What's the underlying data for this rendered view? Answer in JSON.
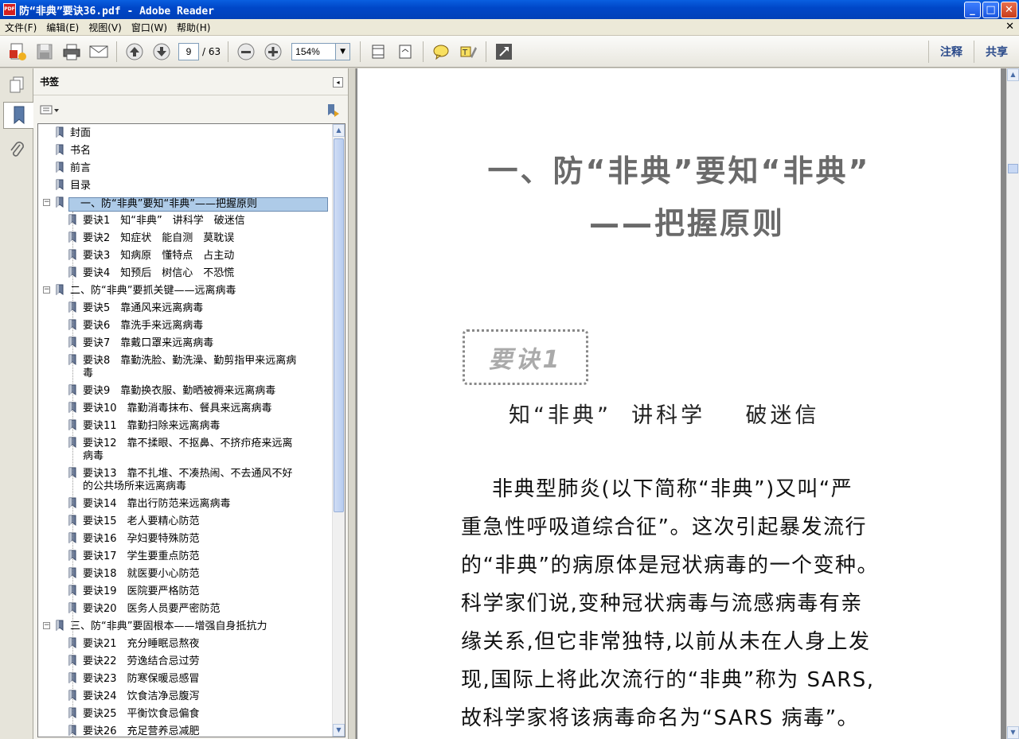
{
  "window": {
    "title": "防“非典”要诀36.pdf - Adobe Reader",
    "app_icon": "PDF",
    "min": "_",
    "max": "□",
    "close": "✕"
  },
  "menu": [
    "文件(F)",
    "编辑(E)",
    "视图(V)",
    "窗口(W)",
    "帮助(H)"
  ],
  "toolbar": {
    "page_current": "9",
    "page_total": "/ 63",
    "zoom": "154%",
    "comment_label": "注释",
    "share_label": "共享"
  },
  "panel": {
    "title": "书签",
    "collapse": "◂"
  },
  "bookmarks": [
    {
      "label": "封面",
      "level": 0,
      "toggle": ""
    },
    {
      "label": "书名",
      "level": 0,
      "toggle": ""
    },
    {
      "label": "前言",
      "level": 0,
      "toggle": ""
    },
    {
      "label": "目录",
      "level": 0,
      "toggle": ""
    },
    {
      "label": "一、防“非典”要知“非典”——把握原则",
      "level": 0,
      "toggle": "−",
      "selected": true
    },
    {
      "label": "要诀1　知“非典”　讲科学　破迷信",
      "level": 1,
      "toggle": ""
    },
    {
      "label": "要诀2　知症状　能自测　莫耽误",
      "level": 1,
      "toggle": ""
    },
    {
      "label": "要诀3　知病原　懂特点　占主动",
      "level": 1,
      "toggle": ""
    },
    {
      "label": "要诀4　知预后　树信心　不恐慌",
      "level": 1,
      "toggle": ""
    },
    {
      "label": "二、防“非典”要抓关键——远离病毒",
      "level": 0,
      "toggle": "−"
    },
    {
      "label": "要诀5　靠通风来远离病毒",
      "level": 1,
      "toggle": ""
    },
    {
      "label": "要诀6　靠洗手来远离病毒",
      "level": 1,
      "toggle": ""
    },
    {
      "label": "要诀7　靠戴口罩来远离病毒",
      "level": 1,
      "toggle": ""
    },
    {
      "label": "要诀8　靠勤洗脸、勤洗澡、勤剪指甲来远离病\n毒",
      "level": 1,
      "toggle": ""
    },
    {
      "label": "要诀9　靠勤换衣服、勤晒被褥来远离病毒",
      "level": 1,
      "toggle": ""
    },
    {
      "label": "要诀10　靠勤消毒抹布、餐具来远离病毒",
      "level": 1,
      "toggle": ""
    },
    {
      "label": "要诀11　靠勤扫除来远离病毒",
      "level": 1,
      "toggle": ""
    },
    {
      "label": "要诀12　靠不揉眼、不抠鼻、不挤疖疮来远离\n病毒",
      "level": 1,
      "toggle": ""
    },
    {
      "label": "要诀13　靠不扎堆、不凑热闹、不去通风不好\n的公共场所来远离病毒",
      "level": 1,
      "toggle": ""
    },
    {
      "label": "要诀14　靠出行防范来远离病毒",
      "level": 1,
      "toggle": ""
    },
    {
      "label": "要诀15　老人要精心防范",
      "level": 1,
      "toggle": ""
    },
    {
      "label": "要诀16　孕妇要特殊防范",
      "level": 1,
      "toggle": ""
    },
    {
      "label": "要诀17　学生要重点防范",
      "level": 1,
      "toggle": ""
    },
    {
      "label": "要诀18　就医要小心防范",
      "level": 1,
      "toggle": ""
    },
    {
      "label": "要诀19　医院要严格防范",
      "level": 1,
      "toggle": ""
    },
    {
      "label": "要诀20　医务人员要严密防范",
      "level": 1,
      "toggle": ""
    },
    {
      "label": "三、防“非典”要固根本——增强自身抵抗力",
      "level": 0,
      "toggle": "−"
    },
    {
      "label": "要诀21　充分睡眠忌熬夜",
      "level": 1,
      "toggle": ""
    },
    {
      "label": "要诀22　劳逸结合忌过劳",
      "level": 1,
      "toggle": ""
    },
    {
      "label": "要诀23　防寒保暖忌感冒",
      "level": 1,
      "toggle": ""
    },
    {
      "label": "要诀24　饮食洁净忌腹泻",
      "level": 1,
      "toggle": ""
    },
    {
      "label": "要诀25　平衡饮食忌偏食",
      "level": 1,
      "toggle": ""
    },
    {
      "label": "要诀26　充足营养忌减肥",
      "level": 1,
      "toggle": ""
    }
  ],
  "document": {
    "heading_line1": "一、防“非典”要知“非典”",
    "heading_line2": "——把握原则",
    "badge": "要诀1",
    "subtitle": "知“非典”  讲科学    破迷信",
    "body": [
      "    非典型肺炎(以下简称“非典”)又叫“严",
      "重急性呼吸道综合征”。这次引起暴发流行",
      "的“非典”的病原体是冠状病毒的一个变种。",
      "科学家们说,变种冠状病毒与流感病毒有亲",
      "缘关系,但它非常独特,以前从未在人身上发",
      "现,国际上将此次流行的“非典”称为 SARS,",
      "故科学家将该病毒命名为“SARS 病毒”。"
    ]
  }
}
